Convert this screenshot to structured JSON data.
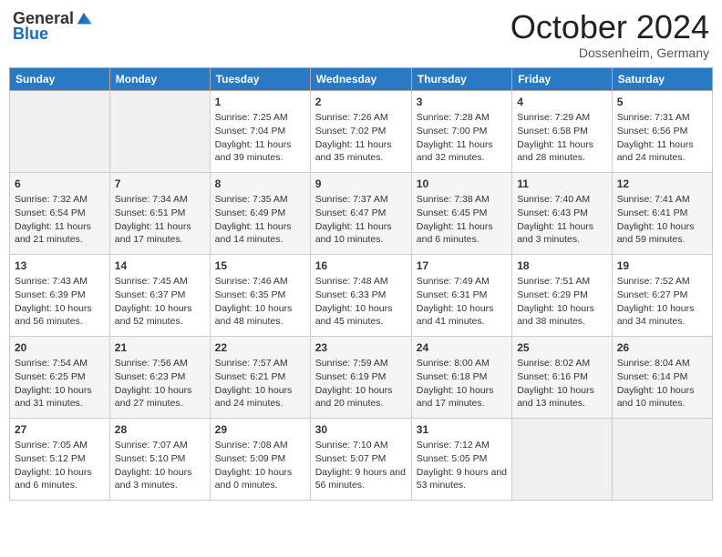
{
  "header": {
    "logo_general": "General",
    "logo_blue": "Blue",
    "month": "October 2024",
    "location": "Dossenheim, Germany"
  },
  "weekdays": [
    "Sunday",
    "Monday",
    "Tuesday",
    "Wednesday",
    "Thursday",
    "Friday",
    "Saturday"
  ],
  "weeks": [
    [
      {
        "day": "",
        "content": ""
      },
      {
        "day": "",
        "content": ""
      },
      {
        "day": "1",
        "content": "Sunrise: 7:25 AM\nSunset: 7:04 PM\nDaylight: 11 hours and 39 minutes."
      },
      {
        "day": "2",
        "content": "Sunrise: 7:26 AM\nSunset: 7:02 PM\nDaylight: 11 hours and 35 minutes."
      },
      {
        "day": "3",
        "content": "Sunrise: 7:28 AM\nSunset: 7:00 PM\nDaylight: 11 hours and 32 minutes."
      },
      {
        "day": "4",
        "content": "Sunrise: 7:29 AM\nSunset: 6:58 PM\nDaylight: 11 hours and 28 minutes."
      },
      {
        "day": "5",
        "content": "Sunrise: 7:31 AM\nSunset: 6:56 PM\nDaylight: 11 hours and 24 minutes."
      }
    ],
    [
      {
        "day": "6",
        "content": "Sunrise: 7:32 AM\nSunset: 6:54 PM\nDaylight: 11 hours and 21 minutes."
      },
      {
        "day": "7",
        "content": "Sunrise: 7:34 AM\nSunset: 6:51 PM\nDaylight: 11 hours and 17 minutes."
      },
      {
        "day": "8",
        "content": "Sunrise: 7:35 AM\nSunset: 6:49 PM\nDaylight: 11 hours and 14 minutes."
      },
      {
        "day": "9",
        "content": "Sunrise: 7:37 AM\nSunset: 6:47 PM\nDaylight: 11 hours and 10 minutes."
      },
      {
        "day": "10",
        "content": "Sunrise: 7:38 AM\nSunset: 6:45 PM\nDaylight: 11 hours and 6 minutes."
      },
      {
        "day": "11",
        "content": "Sunrise: 7:40 AM\nSunset: 6:43 PM\nDaylight: 11 hours and 3 minutes."
      },
      {
        "day": "12",
        "content": "Sunrise: 7:41 AM\nSunset: 6:41 PM\nDaylight: 10 hours and 59 minutes."
      }
    ],
    [
      {
        "day": "13",
        "content": "Sunrise: 7:43 AM\nSunset: 6:39 PM\nDaylight: 10 hours and 56 minutes."
      },
      {
        "day": "14",
        "content": "Sunrise: 7:45 AM\nSunset: 6:37 PM\nDaylight: 10 hours and 52 minutes."
      },
      {
        "day": "15",
        "content": "Sunrise: 7:46 AM\nSunset: 6:35 PM\nDaylight: 10 hours and 48 minutes."
      },
      {
        "day": "16",
        "content": "Sunrise: 7:48 AM\nSunset: 6:33 PM\nDaylight: 10 hours and 45 minutes."
      },
      {
        "day": "17",
        "content": "Sunrise: 7:49 AM\nSunset: 6:31 PM\nDaylight: 10 hours and 41 minutes."
      },
      {
        "day": "18",
        "content": "Sunrise: 7:51 AM\nSunset: 6:29 PM\nDaylight: 10 hours and 38 minutes."
      },
      {
        "day": "19",
        "content": "Sunrise: 7:52 AM\nSunset: 6:27 PM\nDaylight: 10 hours and 34 minutes."
      }
    ],
    [
      {
        "day": "20",
        "content": "Sunrise: 7:54 AM\nSunset: 6:25 PM\nDaylight: 10 hours and 31 minutes."
      },
      {
        "day": "21",
        "content": "Sunrise: 7:56 AM\nSunset: 6:23 PM\nDaylight: 10 hours and 27 minutes."
      },
      {
        "day": "22",
        "content": "Sunrise: 7:57 AM\nSunset: 6:21 PM\nDaylight: 10 hours and 24 minutes."
      },
      {
        "day": "23",
        "content": "Sunrise: 7:59 AM\nSunset: 6:19 PM\nDaylight: 10 hours and 20 minutes."
      },
      {
        "day": "24",
        "content": "Sunrise: 8:00 AM\nSunset: 6:18 PM\nDaylight: 10 hours and 17 minutes."
      },
      {
        "day": "25",
        "content": "Sunrise: 8:02 AM\nSunset: 6:16 PM\nDaylight: 10 hours and 13 minutes."
      },
      {
        "day": "26",
        "content": "Sunrise: 8:04 AM\nSunset: 6:14 PM\nDaylight: 10 hours and 10 minutes."
      }
    ],
    [
      {
        "day": "27",
        "content": "Sunrise: 7:05 AM\nSunset: 5:12 PM\nDaylight: 10 hours and 6 minutes."
      },
      {
        "day": "28",
        "content": "Sunrise: 7:07 AM\nSunset: 5:10 PM\nDaylight: 10 hours and 3 minutes."
      },
      {
        "day": "29",
        "content": "Sunrise: 7:08 AM\nSunset: 5:09 PM\nDaylight: 10 hours and 0 minutes."
      },
      {
        "day": "30",
        "content": "Sunrise: 7:10 AM\nSunset: 5:07 PM\nDaylight: 9 hours and 56 minutes."
      },
      {
        "day": "31",
        "content": "Sunrise: 7:12 AM\nSunset: 5:05 PM\nDaylight: 9 hours and 53 minutes."
      },
      {
        "day": "",
        "content": ""
      },
      {
        "day": "",
        "content": ""
      }
    ]
  ]
}
